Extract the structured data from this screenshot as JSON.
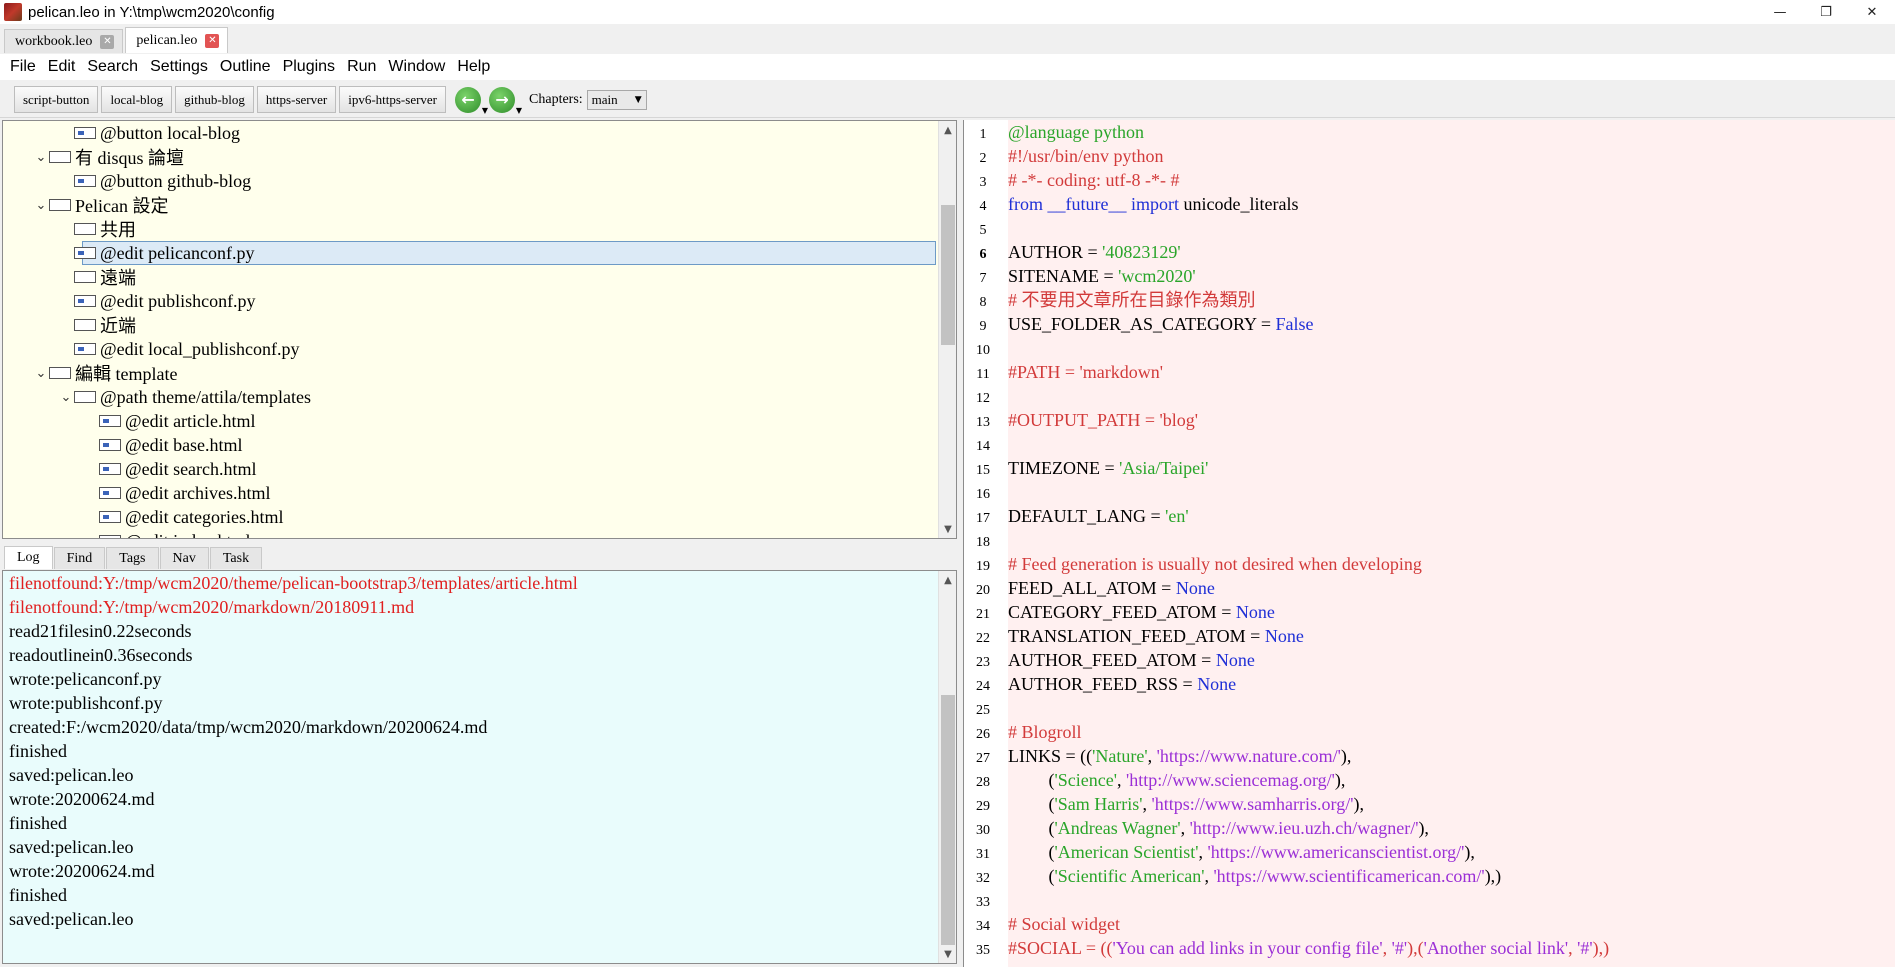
{
  "window": {
    "title": "pelican.leo in Y:\\tmp\\wcm2020\\config",
    "minimize": "—",
    "maximize": "❐",
    "close": "✕"
  },
  "tabs": [
    {
      "label": "workbook.leo",
      "active": false
    },
    {
      "label": "pelican.leo",
      "active": true
    }
  ],
  "menu": [
    "File",
    "Edit",
    "Search",
    "Settings",
    "Outline",
    "Plugins",
    "Run",
    "Window",
    "Help"
  ],
  "toolbar": {
    "buttons": [
      "script-button",
      "local-blog",
      "github-blog",
      "https-server",
      "ipv6-https-server"
    ],
    "back_icon": "←",
    "forward_icon": "→",
    "chapters_label": "Chapters:",
    "chapter_value": "main"
  },
  "outline": {
    "nodes": [
      {
        "label": "@button local-blog",
        "indent": 2,
        "arrow": "",
        "icon": "body"
      },
      {
        "label": "有 disqus 論壇",
        "indent": 1,
        "arrow": "⌄",
        "icon": "empty"
      },
      {
        "label": "@button github-blog",
        "indent": 2,
        "arrow": "",
        "icon": "body"
      },
      {
        "label": "Pelican 設定",
        "indent": 1,
        "arrow": "⌄",
        "icon": "empty"
      },
      {
        "label": "共用",
        "indent": 2,
        "arrow": "",
        "icon": "empty"
      },
      {
        "label": "@edit pelicanconf.py",
        "indent": 2,
        "arrow": "",
        "icon": "body",
        "selected": true
      },
      {
        "label": "遠端",
        "indent": 2,
        "arrow": "",
        "icon": "empty"
      },
      {
        "label": "@edit publishconf.py",
        "indent": 2,
        "arrow": "",
        "icon": "body"
      },
      {
        "label": "近端",
        "indent": 2,
        "arrow": "",
        "icon": "empty"
      },
      {
        "label": "@edit local_publishconf.py",
        "indent": 2,
        "arrow": "",
        "icon": "body"
      },
      {
        "label": "編輯 template",
        "indent": 1,
        "arrow": "⌄",
        "icon": "empty"
      },
      {
        "label": "@path theme/attila/templates",
        "indent": 2,
        "arrow": "⌄",
        "icon": "empty"
      },
      {
        "label": "@edit article.html",
        "indent": 3,
        "arrow": "",
        "icon": "body"
      },
      {
        "label": "@edit base.html",
        "indent": 3,
        "arrow": "",
        "icon": "body"
      },
      {
        "label": "@edit search.html",
        "indent": 3,
        "arrow": "",
        "icon": "body"
      },
      {
        "label": "@edit archives.html",
        "indent": 3,
        "arrow": "",
        "icon": "body"
      },
      {
        "label": "@edit categories.html",
        "indent": 3,
        "arrow": "",
        "icon": "body"
      },
      {
        "label": "@edit index.html",
        "indent": 3,
        "arrow": "",
        "icon": "body"
      }
    ]
  },
  "log_tabs": [
    "Log",
    "Find",
    "Tags",
    "Nav",
    "Task"
  ],
  "log": [
    {
      "text": "filenotfound:Y:/tmp/wcm2020/theme/pelican-bootstrap3/templates/article.html",
      "color": "red"
    },
    {
      "text": "filenotfound:Y:/tmp/wcm2020/markdown/20180911.md",
      "color": "red"
    },
    {
      "text": "read21filesin0.22seconds",
      "color": "black"
    },
    {
      "text": "readoutlinein0.36seconds",
      "color": "black"
    },
    {
      "text": "wrote:pelicanconf.py",
      "color": "black"
    },
    {
      "text": "wrote:publishconf.py",
      "color": "black"
    },
    {
      "text": "created:F:/wcm2020/data/tmp/wcm2020/markdown/20200624.md",
      "color": "black"
    },
    {
      "text": "finished",
      "color": "black"
    },
    {
      "text": "saved:pelican.leo",
      "color": "black"
    },
    {
      "text": "wrote:20200624.md",
      "color": "black"
    },
    {
      "text": "finished",
      "color": "black"
    },
    {
      "text": "saved:pelican.leo",
      "color": "black"
    },
    {
      "text": "wrote:20200624.md",
      "color": "black"
    },
    {
      "text": "finished",
      "color": "black"
    },
    {
      "text": "saved:pelican.leo",
      "color": "black"
    }
  ],
  "editor": {
    "current_line": 6,
    "lines": [
      [
        [
          "@language python",
          "green"
        ]
      ],
      [
        [
          "#!/usr/bin/env python",
          "red"
        ]
      ],
      [
        [
          "# -*- coding: utf-8 -*- #",
          "red"
        ]
      ],
      [
        [
          "from",
          "blue"
        ],
        [
          " ",
          ""
        ],
        [
          "__future__",
          "blue"
        ],
        [
          " ",
          ""
        ],
        [
          "import",
          "blue"
        ],
        [
          " unicode_literals",
          ""
        ]
      ],
      [],
      [
        [
          "AUTHOR = ",
          ""
        ],
        [
          "'40823129'",
          "green"
        ]
      ],
      [
        [
          "SITENAME = ",
          ""
        ],
        [
          "'wcm2020'",
          "green"
        ]
      ],
      [
        [
          "# 不要用文章所在目錄作為類別",
          "red"
        ]
      ],
      [
        [
          "USE_FOLDER_AS_CATEGORY = ",
          ""
        ],
        [
          "False",
          "blue"
        ]
      ],
      [],
      [
        [
          "#PATH = 'markdown'",
          "red"
        ]
      ],
      [],
      [
        [
          "#OUTPUT_PATH = 'blog'",
          "red"
        ]
      ],
      [],
      [
        [
          "TIMEZONE = ",
          ""
        ],
        [
          "'Asia/Taipei'",
          "green"
        ]
      ],
      [],
      [
        [
          "DEFAULT_LANG = ",
          ""
        ],
        [
          "'en'",
          "green"
        ]
      ],
      [],
      [
        [
          "# Feed generation is usually not desired when developing",
          "red"
        ]
      ],
      [
        [
          "FEED_ALL_ATOM = ",
          ""
        ],
        [
          "None",
          "blue"
        ]
      ],
      [
        [
          "CATEGORY_FEED_ATOM = ",
          ""
        ],
        [
          "None",
          "blue"
        ]
      ],
      [
        [
          "TRANSLATION_FEED_ATOM = ",
          ""
        ],
        [
          "None",
          "blue"
        ]
      ],
      [
        [
          "AUTHOR_FEED_ATOM = ",
          ""
        ],
        [
          "None",
          "blue"
        ]
      ],
      [
        [
          "AUTHOR_FEED_RSS = ",
          ""
        ],
        [
          "None",
          "blue"
        ]
      ],
      [],
      [
        [
          "# Blogroll",
          "red"
        ]
      ],
      [
        [
          "LINKS = ((",
          ""
        ],
        [
          "'Nature'",
          "green"
        ],
        [
          ", ",
          ""
        ],
        [
          "'https://www.nature.com/'",
          "purple"
        ],
        [
          "),",
          ""
        ]
      ],
      [
        [
          "         (",
          ""
        ],
        [
          "'Science'",
          "green"
        ],
        [
          ", ",
          ""
        ],
        [
          "'http://www.sciencemag.org/'",
          "purple"
        ],
        [
          "),",
          ""
        ]
      ],
      [
        [
          "         (",
          ""
        ],
        [
          "'Sam Harris'",
          "green"
        ],
        [
          ", ",
          ""
        ],
        [
          "'https://www.samharris.org/'",
          "purple"
        ],
        [
          "),",
          ""
        ]
      ],
      [
        [
          "         (",
          ""
        ],
        [
          "'Andreas Wagner'",
          "green"
        ],
        [
          ", ",
          ""
        ],
        [
          "'http://www.ieu.uzh.ch/wagner/'",
          "purple"
        ],
        [
          "),",
          ""
        ]
      ],
      [
        [
          "         (",
          ""
        ],
        [
          "'American Scientist'",
          "green"
        ],
        [
          ", ",
          ""
        ],
        [
          "'https://www.americanscientist.org/'",
          "purple"
        ],
        [
          "),",
          ""
        ]
      ],
      [
        [
          "         (",
          ""
        ],
        [
          "'Scientific American'",
          "green"
        ],
        [
          ", ",
          ""
        ],
        [
          "'https://www.scientificamerican.com/'",
          "purple"
        ],
        [
          "),)",
          ""
        ]
      ],
      [],
      [
        [
          "# Social widget",
          "red"
        ]
      ],
      [
        [
          "#SOCIAL = ((",
          "red"
        ],
        [
          "'You can add links in your config file'",
          "purple"
        ],
        [
          ", ",
          "red"
        ],
        [
          "'#'",
          "purple"
        ],
        [
          "),(",
          "red"
        ],
        [
          "'Another social link'",
          "purple"
        ],
        [
          ", ",
          "red"
        ],
        [
          "'#'",
          "purple"
        ],
        [
          "),)",
          "red"
        ]
      ]
    ]
  }
}
